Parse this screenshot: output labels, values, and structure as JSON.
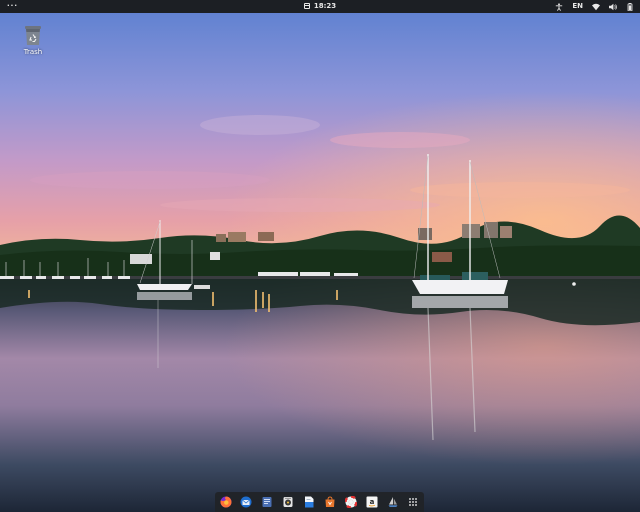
{
  "topbar": {
    "activities_label": "···",
    "clock": "18:23",
    "tray": {
      "lang": "EN",
      "icons": [
        "accessibility-icon",
        "network-wifi-icon",
        "volume-icon",
        "battery-icon"
      ]
    }
  },
  "desktop": {
    "icons": [
      {
        "label": "Trash",
        "icon": "trash-icon"
      }
    ],
    "wallpaper": "harbour-sunset-sailboats"
  },
  "dock": {
    "items": [
      {
        "name": "firefox",
        "icon": "firefox-icon",
        "color": "#ff7139"
      },
      {
        "name": "thunderbird",
        "icon": "thunderbird-icon",
        "color": "#3b8ede"
      },
      {
        "name": "files",
        "icon": "files-icon",
        "color": "#5d83c8"
      },
      {
        "name": "rhythmbox",
        "icon": "rhythmbox-icon",
        "color": "#e0e0e0"
      },
      {
        "name": "writer",
        "icon": "libreoffice-writer-icon",
        "color": "#2a7de1"
      },
      {
        "name": "software",
        "icon": "software-center-icon",
        "color": "#e8772e"
      },
      {
        "name": "help",
        "icon": "help-icon",
        "color": "#e03030"
      },
      {
        "name": "amazon",
        "icon": "amazon-icon",
        "color": "#f4f4f4"
      },
      {
        "name": "sailboat-app",
        "icon": "sailboat-icon",
        "color": "#cfcfcf"
      },
      {
        "name": "show-applications",
        "icon": "app-grid-icon",
        "color": "#ffffff"
      }
    ]
  }
}
